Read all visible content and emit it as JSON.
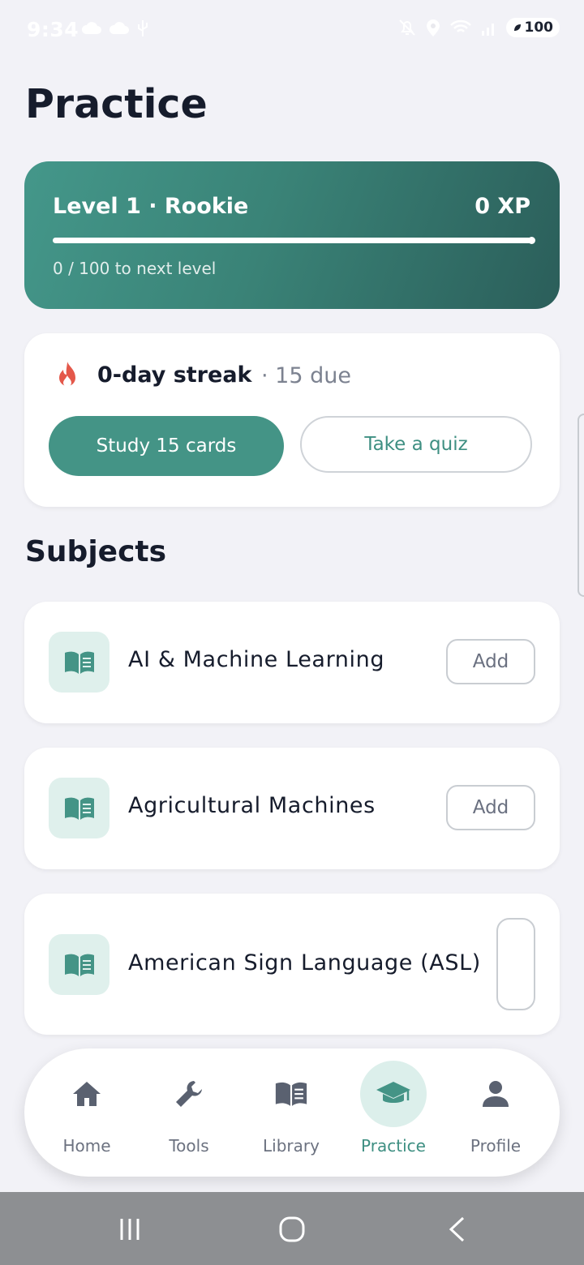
{
  "status_bar": {
    "time": "9:34",
    "battery": "100"
  },
  "page": {
    "title": "Practice"
  },
  "level_card": {
    "level_label": "Level 1 · Rookie",
    "xp_label": "0 XP",
    "progress_fraction": 1.0,
    "next_level_label": "0 / 100 to next level"
  },
  "streak_card": {
    "streak_label": "0-day streak",
    "due_label": "· 15 due",
    "study_button": "Study 15 cards",
    "quiz_button": "Take a quiz"
  },
  "subjects": {
    "title": "Subjects",
    "items": [
      {
        "name": "AI & Machine Learning",
        "action": "Add"
      },
      {
        "name": "Agricultural Machines",
        "action": "Add"
      },
      {
        "name": "American Sign Language (ASL)",
        "action": ""
      }
    ]
  },
  "bottom_nav": {
    "items": [
      {
        "label": "Home",
        "icon": "home-icon"
      },
      {
        "label": "Tools",
        "icon": "wrench-icon"
      },
      {
        "label": "Library",
        "icon": "book-icon"
      },
      {
        "label": "Practice",
        "icon": "graduation-cap-icon",
        "active": true
      },
      {
        "label": "Profile",
        "icon": "person-icon"
      }
    ]
  },
  "colors": {
    "accent": "#449486",
    "accent_light": "#dcefeb",
    "flame": "#e4584a",
    "background": "#f2f2f7"
  }
}
